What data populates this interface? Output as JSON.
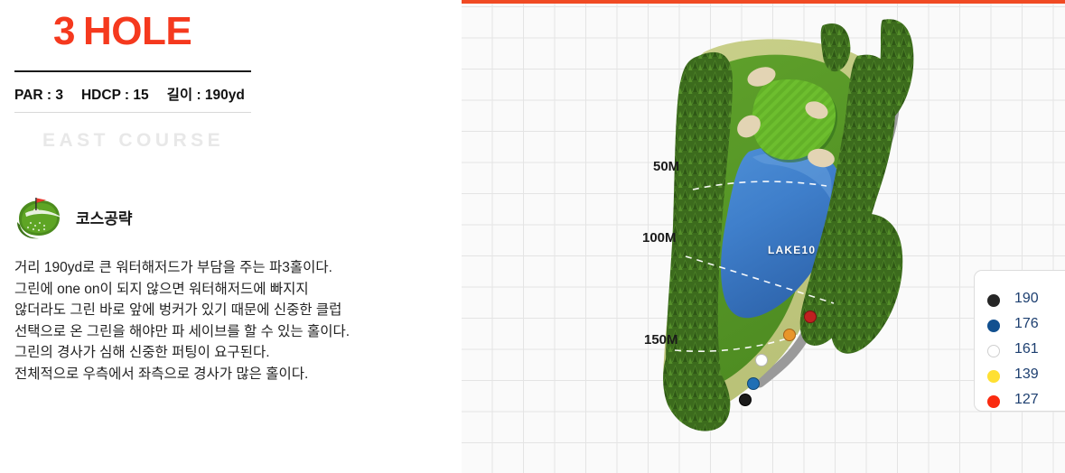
{
  "hole": {
    "number": "3",
    "word": "HOLE",
    "par_label": "PAR : 3",
    "hdcp_label": "HDCP : 15",
    "length_label": "길이 : 190yd",
    "course_name": "EAST COURSE",
    "accent_color": "#F5391E"
  },
  "strategy": {
    "icon": "golf-green-flag-icon",
    "heading": "코스공략",
    "lines": [
      "거리 190yd로 큰 워터해저드가 부담을 주는 파3홀이다.",
      "그린에 one on이 되지 않으면 워터해저드에 빠지지",
      "않더라도 그린 바로 앞에 벙커가 있기 때문에 신중한 클럽",
      "선택으로 온 그린을 해야만 파 세이브를 할 수 있는 홀이다.",
      "그린의 경사가 심해 신중한 퍼팅이 요구된다.",
      "전체적으로 우측에서 좌측으로 경사가 많은 홀이다."
    ]
  },
  "map": {
    "top_border_color": "#F04A23",
    "lake_label": "LAKE10",
    "distance_markers": [
      {
        "label": "50M"
      },
      {
        "label": "100M"
      },
      {
        "label": "150M"
      }
    ],
    "tee_markers": [
      {
        "name": "black-tee",
        "color": "#1a1a1a"
      },
      {
        "name": "blue-tee",
        "color": "#1f6fb5"
      },
      {
        "name": "white-tee",
        "color": "#ffffff"
      },
      {
        "name": "orange-tee",
        "color": "#e8952a"
      },
      {
        "name": "red-tee",
        "color": "#c02020"
      }
    ]
  },
  "legend": {
    "items": [
      {
        "color": "#262626",
        "value": "190",
        "tee": "black"
      },
      {
        "color": "#12508f",
        "value": "176",
        "tee": "blue"
      },
      {
        "color": "#ffffff",
        "value": "161",
        "tee": "white"
      },
      {
        "color": "#FFE033",
        "value": "139",
        "tee": "yellow"
      },
      {
        "color": "#FA2B10",
        "value": "127",
        "tee": "red"
      }
    ]
  }
}
